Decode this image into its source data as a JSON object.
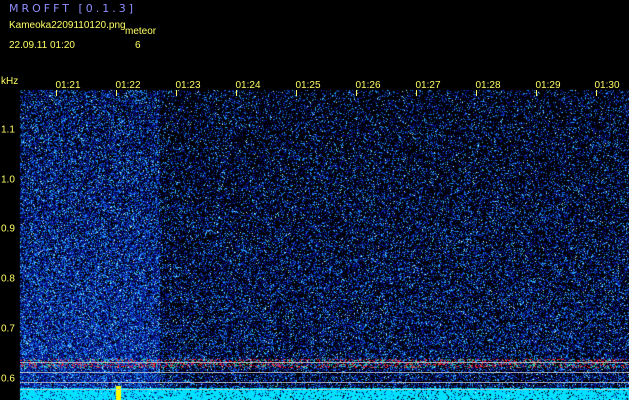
{
  "header": {
    "app_title": "MROFFT [0.1.3]",
    "filename": "Kameoka2209110120.png",
    "meteor_label": "meteor",
    "datetime": "22.09.11 01:20",
    "count": "6"
  },
  "axis": {
    "unit": "kHz",
    "time_labels": [
      "01:21",
      "01:22",
      "01:23",
      "01:24",
      "01:25",
      "01:26",
      "01:27",
      "01:28",
      "01:29",
      "01:30"
    ],
    "freq_labels": [
      "1.1",
      "1.0",
      "0.9",
      "0.8",
      "0.7",
      "0.6"
    ]
  },
  "colors": {
    "background": "#000000",
    "text": "#ffff66",
    "title": "#8f8fff",
    "noise_low": "#08126a",
    "noise_mid": "#1e64ff",
    "noise_high": "#3cd2ff",
    "signal": "#ff2040",
    "floor": "#00e5ff",
    "marker": "#ffff00"
  }
}
